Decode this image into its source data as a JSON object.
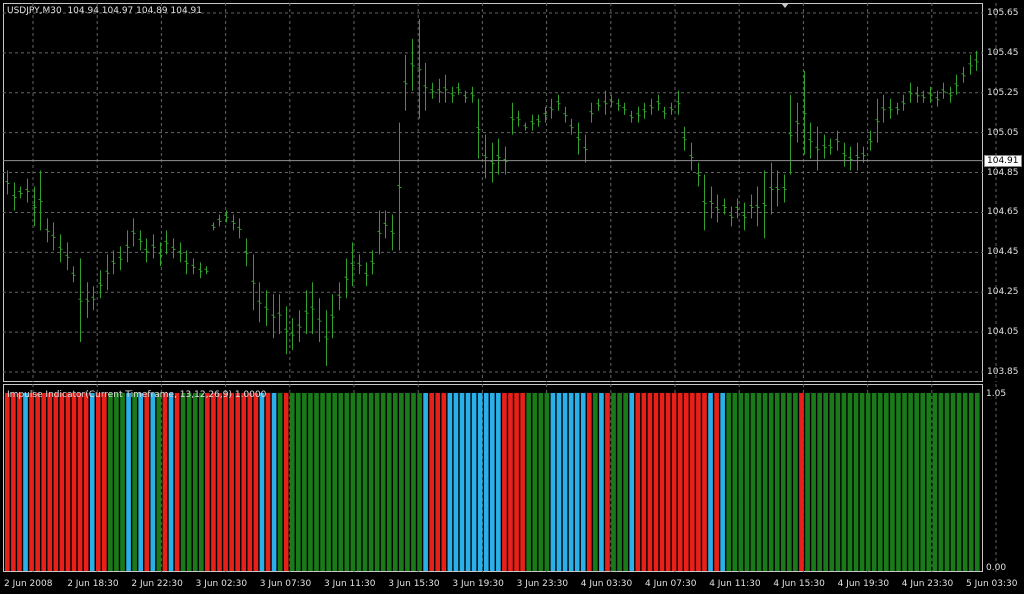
{
  "chart": {
    "symbol_info": "USDJPY,M30",
    "ohlc": "104.94 104.97 104.89 104.91",
    "current_price": "104.91"
  },
  "price_axis": {
    "labels": [
      "105.65",
      "105.45",
      "105.25",
      "105.05",
      "104.85",
      "104.65",
      "104.45",
      "104.25",
      "104.05",
      "103.85"
    ]
  },
  "indicator": {
    "title": "Impulse Indicator(Current Timeframe, 13,12,26,9) 1.0000",
    "axis_top": "1.05",
    "axis_bottom": "0.00"
  },
  "time_axis": {
    "labels": [
      "2 Jun 2008",
      "2 Jun 18:30",
      "2 Jun 22:30",
      "3 Jun 02:30",
      "3 Jun 07:30",
      "3 Jun 11:30",
      "3 Jun 15:30",
      "3 Jun 19:30",
      "3 Jun 23:30",
      "4 Jun 03:30",
      "4 Jun 07:30",
      "4 Jun 11:30",
      "4 Jun 15:30",
      "4 Jun 19:30",
      "4 Jun 23:30",
      "5 Jun 03:30"
    ]
  },
  "colors": {
    "background": "#000000",
    "grid": "#646464",
    "bar": "#32a02d",
    "red": "#e8201a",
    "green": "#1a7a1a",
    "blue": "#2ab0e8",
    "price_line": "#909090"
  },
  "chart_data": {
    "type": "bar",
    "price_series": {
      "name": "USDJPY,M30",
      "ylim": [
        103.8,
        105.7
      ],
      "bars": [
        [
          104.86,
          104.74
        ],
        [
          104.8,
          104.66
        ],
        [
          104.78,
          104.72
        ],
        [
          104.82,
          104.7
        ],
        [
          104.78,
          104.58
        ],
        [
          104.86,
          104.56
        ],
        [
          104.62,
          104.5
        ],
        [
          104.6,
          104.46
        ],
        [
          104.54,
          104.4
        ],
        [
          104.5,
          104.36
        ],
        [
          104.38,
          104.3
        ],
        [
          104.42,
          104.0
        ],
        [
          104.3,
          104.12
        ],
        [
          104.28,
          104.16
        ],
        [
          104.36,
          104.22
        ],
        [
          104.44,
          104.26
        ],
        [
          104.46,
          104.34
        ],
        [
          104.48,
          104.36
        ],
        [
          104.56,
          104.4
        ],
        [
          104.62,
          104.48
        ],
        [
          104.56,
          104.46
        ],
        [
          104.52,
          104.4
        ],
        [
          104.54,
          104.42
        ],
        [
          104.5,
          104.38
        ],
        [
          104.56,
          104.44
        ],
        [
          104.52,
          104.42
        ],
        [
          104.5,
          104.4
        ],
        [
          104.46,
          104.34
        ],
        [
          104.42,
          104.34
        ],
        [
          104.4,
          104.32
        ],
        [
          104.38,
          104.34
        ],
        [
          104.6,
          104.56
        ],
        [
          104.64,
          104.58
        ],
        [
          104.66,
          104.6
        ],
        [
          104.64,
          104.56
        ],
        [
          104.62,
          104.52
        ],
        [
          104.52,
          104.38
        ],
        [
          104.44,
          104.16
        ],
        [
          104.3,
          104.1
        ],
        [
          104.26,
          104.08
        ],
        [
          104.24,
          104.02
        ],
        [
          104.24,
          104.04
        ],
        [
          104.18,
          103.94
        ],
        [
          104.12,
          103.96
        ],
        [
          104.16,
          104.0
        ],
        [
          104.26,
          104.04
        ],
        [
          104.3,
          104.04
        ],
        [
          104.22,
          104.0
        ],
        [
          104.16,
          103.88
        ],
        [
          104.24,
          104.02
        ],
        [
          104.3,
          104.16
        ],
        [
          104.42,
          104.22
        ],
        [
          104.5,
          104.28
        ],
        [
          104.44,
          104.34
        ],
        [
          104.4,
          104.28
        ],
        [
          104.46,
          104.34
        ],
        [
          104.66,
          104.44
        ],
        [
          104.66,
          104.52
        ],
        [
          104.64,
          104.46
        ],
        [
          105.1,
          104.46
        ],
        [
          105.44,
          105.16
        ],
        [
          105.52,
          105.26
        ],
        [
          105.62,
          105.12
        ],
        [
          105.4,
          105.16
        ],
        [
          105.3,
          105.22
        ],
        [
          105.32,
          105.2
        ],
        [
          105.34,
          105.2
        ],
        [
          105.28,
          105.2
        ],
        [
          105.3,
          105.24
        ],
        [
          105.26,
          105.2
        ],
        [
          105.28,
          105.2
        ],
        [
          105.22,
          104.92
        ],
        [
          105.04,
          104.82
        ],
        [
          105.0,
          104.8
        ],
        [
          105.02,
          104.84
        ],
        [
          104.98,
          104.84
        ],
        [
          105.2,
          105.04
        ],
        [
          105.16,
          105.08
        ],
        [
          105.1,
          105.06
        ],
        [
          105.14,
          105.06
        ],
        [
          105.14,
          105.08
        ],
        [
          105.18,
          105.1
        ],
        [
          105.22,
          105.12
        ],
        [
          105.24,
          105.16
        ],
        [
          105.18,
          105.1
        ],
        [
          105.12,
          105.04
        ],
        [
          105.1,
          104.94
        ],
        [
          105.04,
          104.9
        ],
        [
          105.2,
          105.1
        ],
        [
          105.22,
          105.16
        ],
        [
          105.26,
          105.14
        ],
        [
          105.24,
          105.18
        ],
        [
          105.22,
          105.16
        ],
        [
          105.2,
          105.14
        ],
        [
          105.16,
          105.1
        ],
        [
          105.18,
          105.1
        ],
        [
          105.2,
          105.12
        ],
        [
          105.22,
          105.14
        ],
        [
          105.24,
          105.16
        ],
        [
          105.18,
          105.12
        ],
        [
          105.2,
          105.14
        ],
        [
          105.26,
          105.14
        ],
        [
          105.08,
          104.96
        ],
        [
          105.0,
          104.86
        ],
        [
          104.9,
          104.78
        ],
        [
          104.84,
          104.56
        ],
        [
          104.78,
          104.62
        ],
        [
          104.74,
          104.6
        ],
        [
          104.72,
          104.64
        ],
        [
          104.68,
          104.58
        ],
        [
          104.72,
          104.62
        ],
        [
          104.7,
          104.56
        ],
        [
          104.74,
          104.62
        ],
        [
          104.78,
          104.58
        ],
        [
          104.86,
          104.52
        ],
        [
          104.9,
          104.64
        ],
        [
          104.86,
          104.68
        ],
        [
          104.84,
          104.7
        ],
        [
          105.24,
          104.84
        ],
        [
          105.2,
          105.0
        ],
        [
          105.36,
          104.94
        ],
        [
          105.1,
          104.92
        ],
        [
          105.08,
          104.86
        ],
        [
          105.04,
          104.92
        ],
        [
          105.02,
          104.94
        ],
        [
          105.06,
          104.96
        ],
        [
          105.0,
          104.88
        ],
        [
          104.98,
          104.86
        ],
        [
          105.0,
          104.86
        ],
        [
          104.98,
          104.9
        ],
        [
          105.06,
          104.96
        ],
        [
          105.22,
          105.0
        ],
        [
          105.24,
          105.1
        ],
        [
          105.22,
          105.12
        ],
        [
          105.2,
          105.14
        ],
        [
          105.24,
          105.16
        ],
        [
          105.3,
          105.2
        ],
        [
          105.28,
          105.2
        ],
        [
          105.26,
          105.2
        ],
        [
          105.28,
          105.2
        ],
        [
          105.26,
          105.18
        ],
        [
          105.3,
          105.22
        ],
        [
          105.28,
          105.2
        ],
        [
          105.34,
          105.24
        ],
        [
          105.38,
          105.3
        ],
        [
          105.44,
          105.34
        ],
        [
          105.46,
          105.36
        ]
      ]
    },
    "impulse_series": {
      "name": "Impulse Indicator(Current Timeframe, 13,12,26,9) 1.0000",
      "ylim": [
        0,
        1.05
      ],
      "value": 1.0,
      "colors": "RRRBRRRRRRRRRRBRRGGGBGBRBGRBRGGGGRRRRRRRRRBRBGRGGGGGGGGGGGGGGGGGGGGGGBRRRBBBBBBBBBRRRRGGGGBBBBBBRGBRGGGBRRRRRRRRRRRRBRBGGGGGGGGGGGGRGGGGGGGGGGGGGGGGGGGGGGGGGGGGG"
    }
  }
}
